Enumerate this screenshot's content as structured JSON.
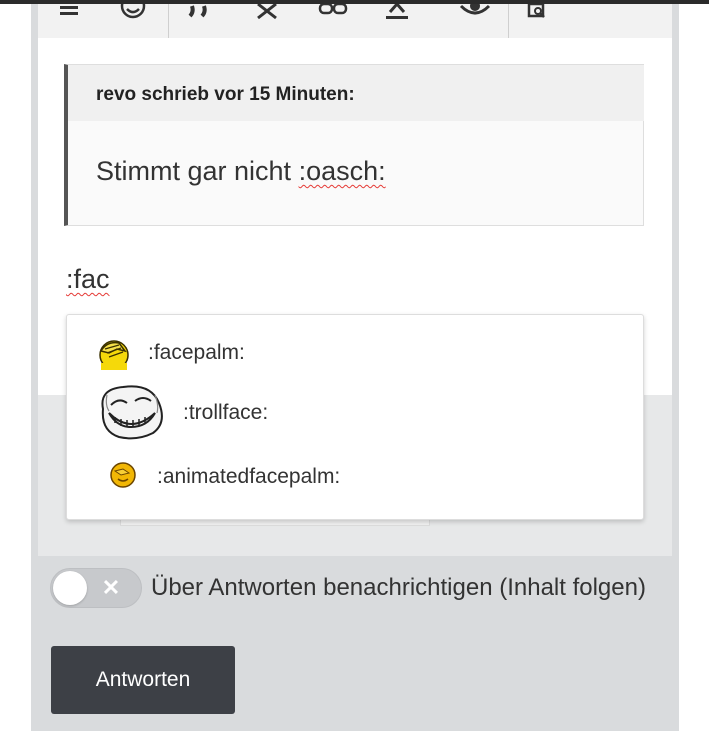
{
  "toolbar": {
    "icons": [
      "list-icon",
      "smiley-icon",
      "quote-icon",
      "clear-format-icon",
      "link-icon",
      "text-color-icon",
      "preview-icon",
      "source-icon"
    ]
  },
  "quote": {
    "header": "revo schrieb vor 15 Minuten:",
    "body_prefix": "Stimmt gar nicht ",
    "body_emoji": ":oasch:"
  },
  "editor": {
    "typed_text": ":fac"
  },
  "suggestions": [
    {
      "code": ":facepalm:",
      "icon": "facepalm-emoji-icon"
    },
    {
      "code": ":trollface:",
      "icon": "trollface-emoji-icon"
    },
    {
      "code": ":animatedfacepalm:",
      "icon": "animated-facepalm-emoji-icon"
    }
  ],
  "follow": {
    "label": "Über Antworten benachrichtigen (Inhalt folgen)",
    "checked": false
  },
  "reply_button": "Antworten",
  "colors": {
    "button_bg": "#3d4046",
    "panel_bg": "#d9dbdd",
    "spell_underline": "#e53935",
    "emoji_yellow": "#f5d90a"
  }
}
